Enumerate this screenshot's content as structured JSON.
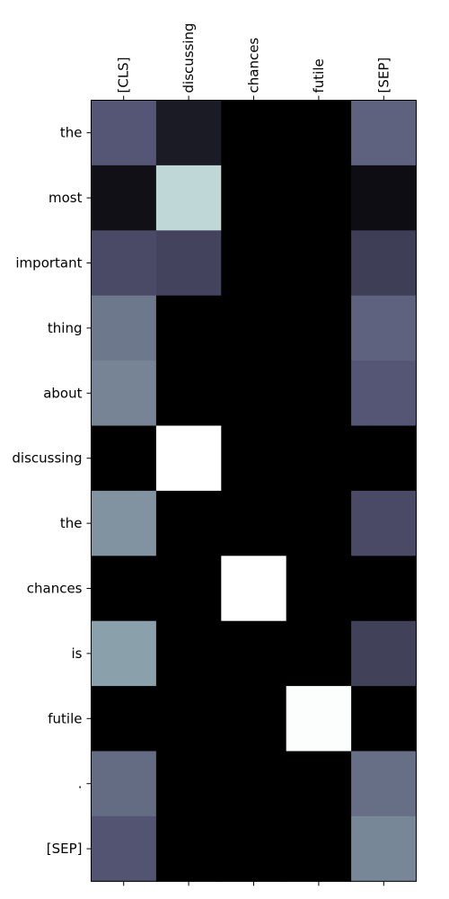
{
  "chart_data": {
    "type": "heatmap",
    "colormap": "bone",
    "x_labels": [
      "[CLS]",
      "discussing",
      "chances",
      "futile",
      "[SEP]"
    ],
    "y_labels": [
      "the",
      "most",
      "important",
      "thing",
      "about",
      "discussing",
      "the",
      "chances",
      "is",
      "futile",
      ".",
      "[SEP]"
    ],
    "values": [
      [
        0.38,
        0.12,
        0.0,
        0.0,
        0.42
      ],
      [
        0.07,
        0.82,
        0.0,
        0.0,
        0.06
      ],
      [
        0.33,
        0.3,
        0.0,
        0.0,
        0.28
      ],
      [
        0.49,
        0.0,
        0.0,
        0.0,
        0.42
      ],
      [
        0.53,
        0.0,
        0.0,
        0.0,
        0.38
      ],
      [
        0.0,
        1.0,
        0.0,
        0.0,
        0.0
      ],
      [
        0.58,
        0.0,
        0.0,
        0.0,
        0.33
      ],
      [
        0.0,
        0.0,
        1.0,
        0.0,
        0.0
      ],
      [
        0.62,
        0.0,
        0.0,
        0.0,
        0.29
      ],
      [
        0.0,
        0.0,
        0.0,
        0.99,
        0.0
      ],
      [
        0.45,
        0.0,
        0.0,
        0.0,
        0.46
      ],
      [
        0.37,
        0.0,
        0.0,
        0.0,
        0.54
      ]
    ],
    "vmin": 0,
    "vmax": 1,
    "x_axis_position": "top",
    "grid": false
  }
}
